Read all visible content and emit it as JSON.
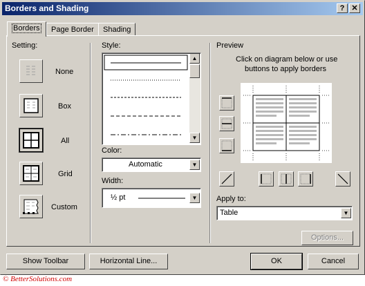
{
  "window": {
    "title": "Borders and Shading"
  },
  "titlebar_buttons": {
    "help": "?",
    "close": "✕"
  },
  "tabs": [
    {
      "label": "Borders",
      "active": true
    },
    {
      "label": "Page Border",
      "active": false
    },
    {
      "label": "Shading",
      "active": false
    }
  ],
  "setting": {
    "heading": "Setting:",
    "options": [
      {
        "label": "None",
        "icon": "setting-none-icon"
      },
      {
        "label": "Box",
        "icon": "setting-box-icon"
      },
      {
        "label": "All",
        "icon": "setting-all-icon",
        "selected": true
      },
      {
        "label": "Grid",
        "icon": "setting-grid-icon"
      },
      {
        "label": "Custom",
        "icon": "setting-custom-icon"
      }
    ]
  },
  "style": {
    "heading": "Style:",
    "line_styles": [
      "solid",
      "dotted",
      "dashed-small",
      "dashed",
      "dash-dot"
    ]
  },
  "color": {
    "heading": "Color:",
    "value": "Automatic"
  },
  "width": {
    "heading": "Width:",
    "value": "½ pt"
  },
  "preview": {
    "heading": "Preview",
    "instructions_line1": "Click on diagram below or use",
    "instructions_line2": "buttons to apply borders"
  },
  "apply_to": {
    "heading": "Apply to:",
    "value": "Table"
  },
  "buttons": {
    "options": "Options...",
    "show_toolbar": "Show Toolbar",
    "horizontal_line": "Horizontal Line...",
    "ok": "OK",
    "cancel": "Cancel"
  },
  "watermark": "© BetterSolutions.com"
}
